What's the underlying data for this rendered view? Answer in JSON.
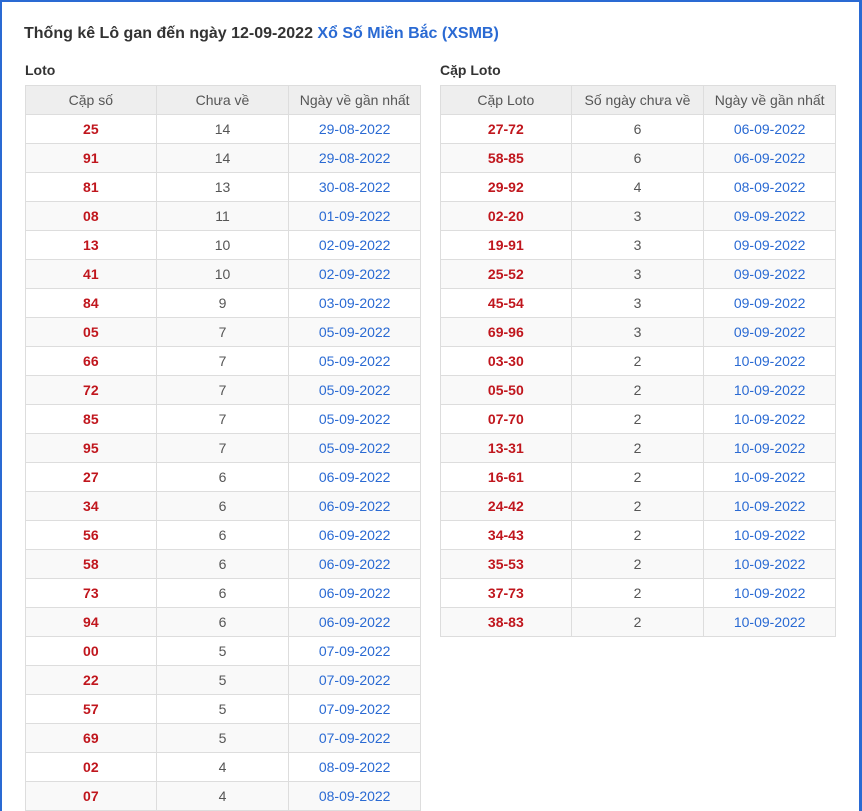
{
  "title": {
    "prefix": "Thống kê Lô gan đến ngày 12-09-2022",
    "link": "Xổ Số Miền Bắc (XSMB)"
  },
  "loto": {
    "label": "Loto",
    "headers": [
      "Cặp số",
      "Chưa về",
      "Ngày về gần nhất"
    ],
    "rows": [
      [
        "25",
        "14",
        "29-08-2022"
      ],
      [
        "91",
        "14",
        "29-08-2022"
      ],
      [
        "81",
        "13",
        "30-08-2022"
      ],
      [
        "08",
        "11",
        "01-09-2022"
      ],
      [
        "13",
        "10",
        "02-09-2022"
      ],
      [
        "41",
        "10",
        "02-09-2022"
      ],
      [
        "84",
        "9",
        "03-09-2022"
      ],
      [
        "05",
        "7",
        "05-09-2022"
      ],
      [
        "66",
        "7",
        "05-09-2022"
      ],
      [
        "72",
        "7",
        "05-09-2022"
      ],
      [
        "85",
        "7",
        "05-09-2022"
      ],
      [
        "95",
        "7",
        "05-09-2022"
      ],
      [
        "27",
        "6",
        "06-09-2022"
      ],
      [
        "34",
        "6",
        "06-09-2022"
      ],
      [
        "56",
        "6",
        "06-09-2022"
      ],
      [
        "58",
        "6",
        "06-09-2022"
      ],
      [
        "73",
        "6",
        "06-09-2022"
      ],
      [
        "94",
        "6",
        "06-09-2022"
      ],
      [
        "00",
        "5",
        "07-09-2022"
      ],
      [
        "22",
        "5",
        "07-09-2022"
      ],
      [
        "57",
        "5",
        "07-09-2022"
      ],
      [
        "69",
        "5",
        "07-09-2022"
      ],
      [
        "02",
        "4",
        "08-09-2022"
      ],
      [
        "07",
        "4",
        "08-09-2022"
      ]
    ]
  },
  "cap_loto": {
    "label": "Cặp Loto",
    "headers": [
      "Cặp Loto",
      "Số ngày chưa về",
      "Ngày về gần nhất"
    ],
    "rows": [
      [
        "27-72",
        "6",
        "06-09-2022"
      ],
      [
        "58-85",
        "6",
        "06-09-2022"
      ],
      [
        "29-92",
        "4",
        "08-09-2022"
      ],
      [
        "02-20",
        "3",
        "09-09-2022"
      ],
      [
        "19-91",
        "3",
        "09-09-2022"
      ],
      [
        "25-52",
        "3",
        "09-09-2022"
      ],
      [
        "45-54",
        "3",
        "09-09-2022"
      ],
      [
        "69-96",
        "3",
        "09-09-2022"
      ],
      [
        "03-30",
        "2",
        "10-09-2022"
      ],
      [
        "05-50",
        "2",
        "10-09-2022"
      ],
      [
        "07-70",
        "2",
        "10-09-2022"
      ],
      [
        "13-31",
        "2",
        "10-09-2022"
      ],
      [
        "16-61",
        "2",
        "10-09-2022"
      ],
      [
        "24-42",
        "2",
        "10-09-2022"
      ],
      [
        "34-43",
        "2",
        "10-09-2022"
      ],
      [
        "35-53",
        "2",
        "10-09-2022"
      ],
      [
        "37-73",
        "2",
        "10-09-2022"
      ],
      [
        "38-83",
        "2",
        "10-09-2022"
      ]
    ]
  },
  "colors": {
    "accent": "#2a6ad3",
    "number": "#c0161d",
    "header_bg": "#eeeeee"
  }
}
